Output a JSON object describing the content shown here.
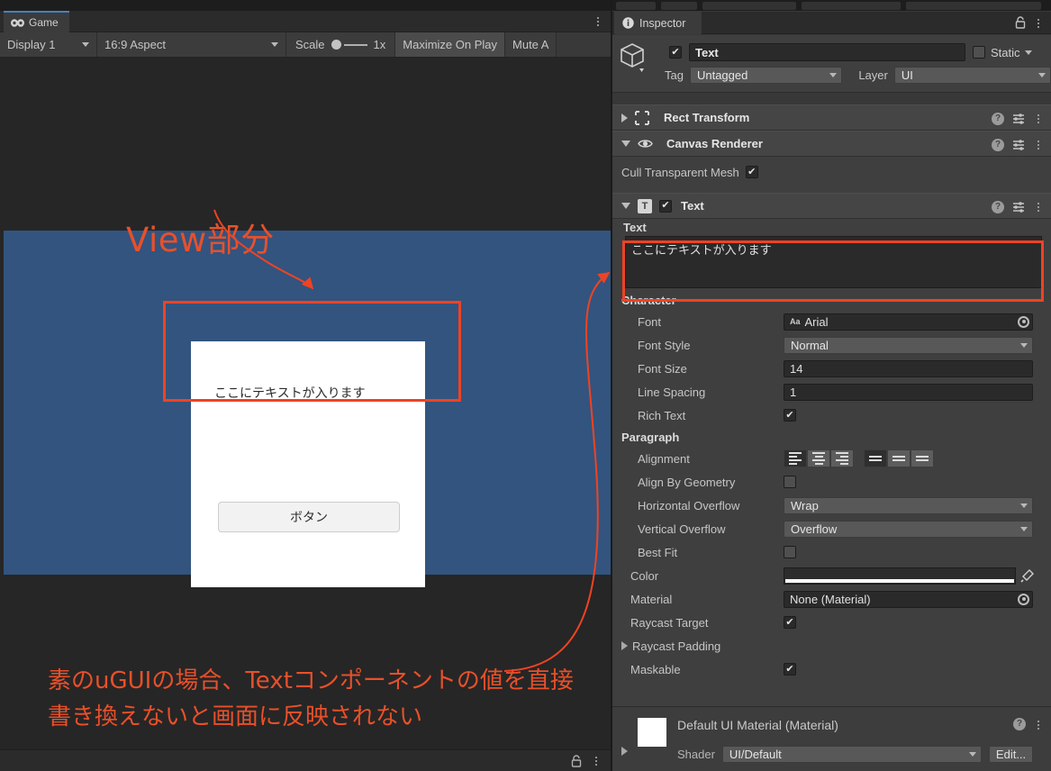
{
  "game_panel": {
    "tab_label": "Game",
    "tab_icon": "gamepad-icon",
    "toolbar": {
      "display": "Display 1",
      "aspect": "16:9 Aspect",
      "scale_label": "Scale",
      "scale_value": "1x",
      "maximize_on_play": "Maximize On Play",
      "mute_audio": "Mute A"
    },
    "render": {
      "background_color": "#32547F",
      "card_text": "ここにテキストが入ります",
      "button_label": "ボタン"
    },
    "annotations": {
      "title": "View部分",
      "caption": "素のuGUIの場合、Textコンポーネントの値を直接書き換えないと画面に反映されない",
      "color": "#EF4323"
    }
  },
  "inspector": {
    "tab_label": "Inspector",
    "tab_icon": "info-icon",
    "gameobject": {
      "enabled": true,
      "name": "Text",
      "static_label": "Static",
      "static_checked": false,
      "tag_label": "Tag",
      "tag_value": "Untagged",
      "layer_label": "Layer",
      "layer_value": "UI"
    },
    "components": [
      {
        "name": "Rect Transform",
        "expanded": false,
        "icon": "rect-transform-icon"
      },
      {
        "name": "Canvas Renderer",
        "expanded": true,
        "icon": "eye-icon"
      },
      {
        "name": "Text",
        "expanded": true,
        "icon": "text-icon",
        "enabled": true
      }
    ],
    "canvas_renderer": {
      "cull_transparent_mesh_label": "Cull Transparent Mesh",
      "cull_transparent_mesh_checked": true
    },
    "text_component": {
      "text_label": "Text",
      "text_value": "ここにテキストが入ります",
      "character_group": "Character",
      "font_label": "Font",
      "font_value": "Arial",
      "font_style_label": "Font Style",
      "font_style_value": "Normal",
      "font_size_label": "Font Size",
      "font_size_value": "14",
      "line_spacing_label": "Line Spacing",
      "line_spacing_value": "1",
      "rich_text_label": "Rich Text",
      "rich_text_checked": true,
      "paragraph_group": "Paragraph",
      "alignment_label": "Alignment",
      "alignment_horizontal": "left",
      "alignment_vertical": "top",
      "align_by_geometry_label": "Align By Geometry",
      "align_by_geometry_checked": false,
      "horizontal_overflow_label": "Horizontal Overflow",
      "horizontal_overflow_value": "Wrap",
      "vertical_overflow_label": "Vertical Overflow",
      "vertical_overflow_value": "Overflow",
      "best_fit_label": "Best Fit",
      "best_fit_checked": false,
      "color_label": "Color",
      "color_value": "#FFFFFF",
      "material_label": "Material",
      "material_value": "None (Material)",
      "raycast_target_label": "Raycast Target",
      "raycast_target_checked": true,
      "raycast_padding_label": "Raycast Padding",
      "maskable_label": "Maskable",
      "maskable_checked": true
    },
    "material_footer": {
      "title": "Default UI Material (Material)",
      "shader_label": "Shader",
      "shader_value": "UI/Default",
      "edit_label": "Edit..."
    }
  }
}
